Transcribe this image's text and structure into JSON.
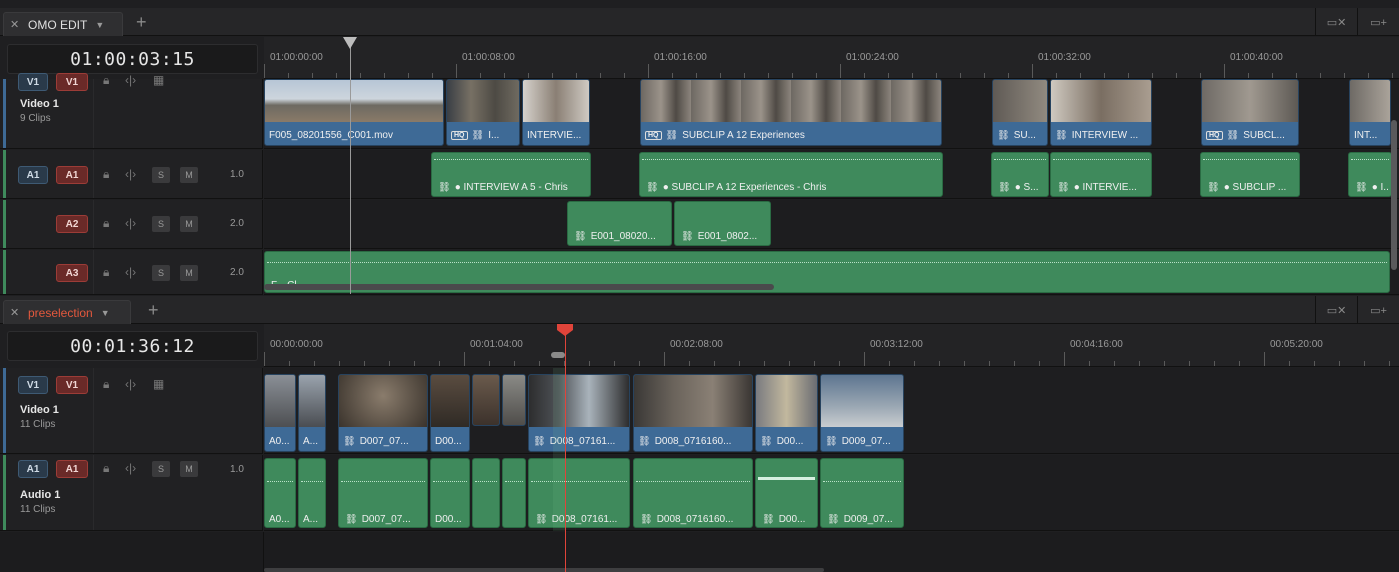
{
  "top_panel": {
    "tab": {
      "name": "OMO EDIT"
    },
    "timecode": "01:00:03:15",
    "ruler_labels": [
      "01:00:00:00",
      "01:00:08:00",
      "01:00:16:00",
      "01:00:24:00",
      "01:00:32:00",
      "01:00:40:00"
    ],
    "video_track": {
      "patch": "V1",
      "dest": "V1",
      "name": "Video 1",
      "clips_count": "9 Clips"
    },
    "audio_tracks": [
      {
        "patch": "A1",
        "dest": "A1",
        "level": "1.0"
      },
      {
        "dest": "A2",
        "level": "2.0"
      },
      {
        "dest": "A3",
        "level": "2.0"
      }
    ],
    "video_clips": [
      {
        "label": "F005_08201556_C001.mov"
      },
      {
        "label": "I..."
      },
      {
        "label": "INTERVIE..."
      },
      {
        "label": "SUBCLIP A 12 Experiences"
      },
      {
        "label": "SU..."
      },
      {
        "label": "INTERVIEW ..."
      },
      {
        "label": "SUBCL..."
      },
      {
        "label": "INT..."
      }
    ],
    "a1_clips": [
      {
        "label": "● INTERVIEW A 5 - Chris"
      },
      {
        "label": "● SUBCLIP A 12 Experiences - Chris"
      },
      {
        "label": "● S..."
      },
      {
        "label": "● INTERVIE..."
      },
      {
        "label": "● SUBCLIP ..."
      },
      {
        "label": "● I..."
      }
    ],
    "a2_clips": [
      {
        "label": "E001_08020..."
      },
      {
        "label": "E001_0802..."
      }
    ],
    "a3_clip": {
      "label": "F...   Cl..."
    }
  },
  "bottom_panel": {
    "tab": {
      "name": "preselection"
    },
    "timecode": "00:01:36:12",
    "ruler_labels": [
      "00:00:00:00",
      "00:01:04:00",
      "00:02:08:00",
      "00:03:12:00",
      "00:04:16:00",
      "00:05:20:00"
    ],
    "video_track": {
      "patch": "V1",
      "dest": "V1",
      "name": "Video 1",
      "clips_count": "11 Clips"
    },
    "audio_track": {
      "patch": "A1",
      "dest": "A1",
      "name": "Audio 1",
      "clips_count": "11 Clips",
      "level": "1.0"
    },
    "video_clips": [
      {
        "label": "A0..."
      },
      {
        "label": "A..."
      },
      {
        "label": "D007_07..."
      },
      {
        "label": "D00..."
      },
      {
        "label": "D008_07161..."
      },
      {
        "label": "D008_0716160..."
      },
      {
        "label": "D00..."
      },
      {
        "label": "D009_07..."
      }
    ],
    "audio_clips": [
      {
        "label": "A0..."
      },
      {
        "label": "A..."
      },
      {
        "label": "D007_07..."
      },
      {
        "label": "D00..."
      },
      {
        "label": "D008_07161..."
      },
      {
        "label": "D008_0716160..."
      },
      {
        "label": "D00..."
      },
      {
        "label": "D009_07..."
      }
    ]
  },
  "controls": {
    "solo": "S",
    "mute": "M",
    "close": "✕",
    "chevron": "⌵",
    "add": "+"
  },
  "colors": {
    "video_clip": "#3e6a96",
    "audio_clip": "#3f8a5c",
    "playhead_red": "#e0443a",
    "dest_red": "#6a2a28"
  }
}
